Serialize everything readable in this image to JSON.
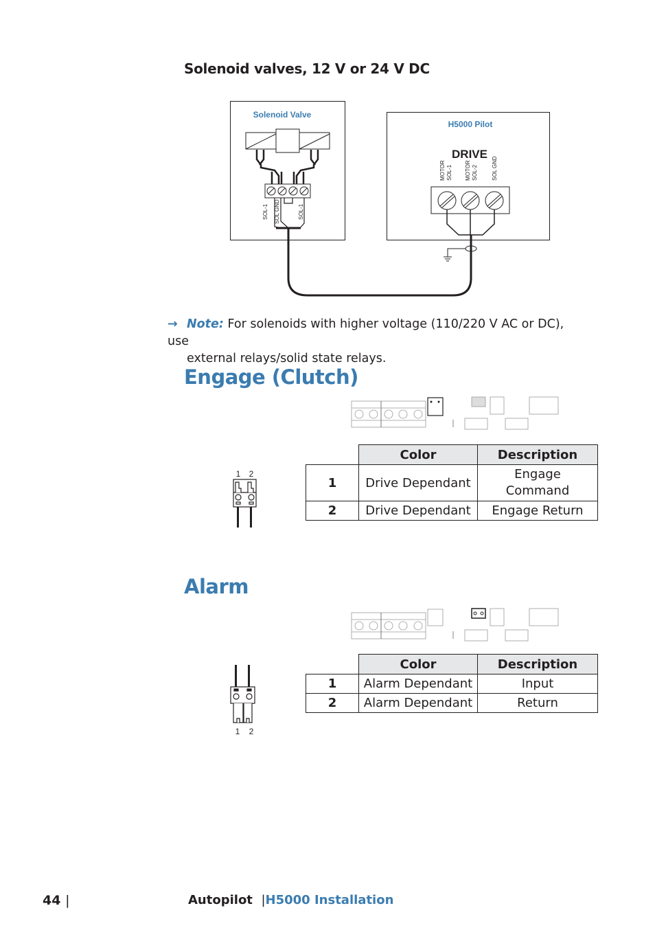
{
  "page": {
    "subheading": "Solenoid valves, 12 V or 24 V DC",
    "diagram": {
      "valve_box_title": "Solenoid Valve",
      "valve_labels": [
        "SOL-1",
        "SOL GND",
        "SOL-1"
      ],
      "pilot_box_title": "H5000 Pilot",
      "pilot_connector": "DRIVE",
      "pilot_labels": [
        {
          "line1": "MOTOR",
          "line2": "SOL-1"
        },
        {
          "line1": "MOTOR",
          "line2": "SOL-2"
        },
        {
          "line1": "SOL GND",
          "line2": ""
        }
      ]
    },
    "note": {
      "arrow_icon": "→",
      "label": "Note:",
      "text_line1": " For solenoids with higher voltage (110/220 V AC or DC), use",
      "text_line2": "external relays/solid state relays."
    },
    "engage": {
      "title": "Engage (Clutch)",
      "connector_pins": [
        "1",
        "2"
      ],
      "table": {
        "headers": [
          "",
          "Color",
          "Description"
        ],
        "rows": [
          {
            "pin": "1",
            "color": "Drive Dependant",
            "description_line1": "Engage",
            "description_line2": "Command"
          },
          {
            "pin": "2",
            "color": "Drive Dependant",
            "description_line1": "Engage Return",
            "description_line2": ""
          }
        ]
      }
    },
    "alarm": {
      "title": "Alarm",
      "connector_pins": [
        "1",
        "2"
      ],
      "table": {
        "headers": [
          "",
          "Color",
          "Description"
        ],
        "rows": [
          {
            "pin": "1",
            "color": "Alarm Dependant",
            "description": "Input"
          },
          {
            "pin": "2",
            "color": "Alarm Dependant",
            "description": "Return"
          }
        ]
      }
    },
    "footer": {
      "page_number": "44",
      "separator": "|",
      "section": "Autopilot",
      "document": "H5000 Installation"
    },
    "colors": {
      "accent": "#3a7cb0",
      "text": "#231f20",
      "header_fill": "#e6e7e8"
    }
  }
}
